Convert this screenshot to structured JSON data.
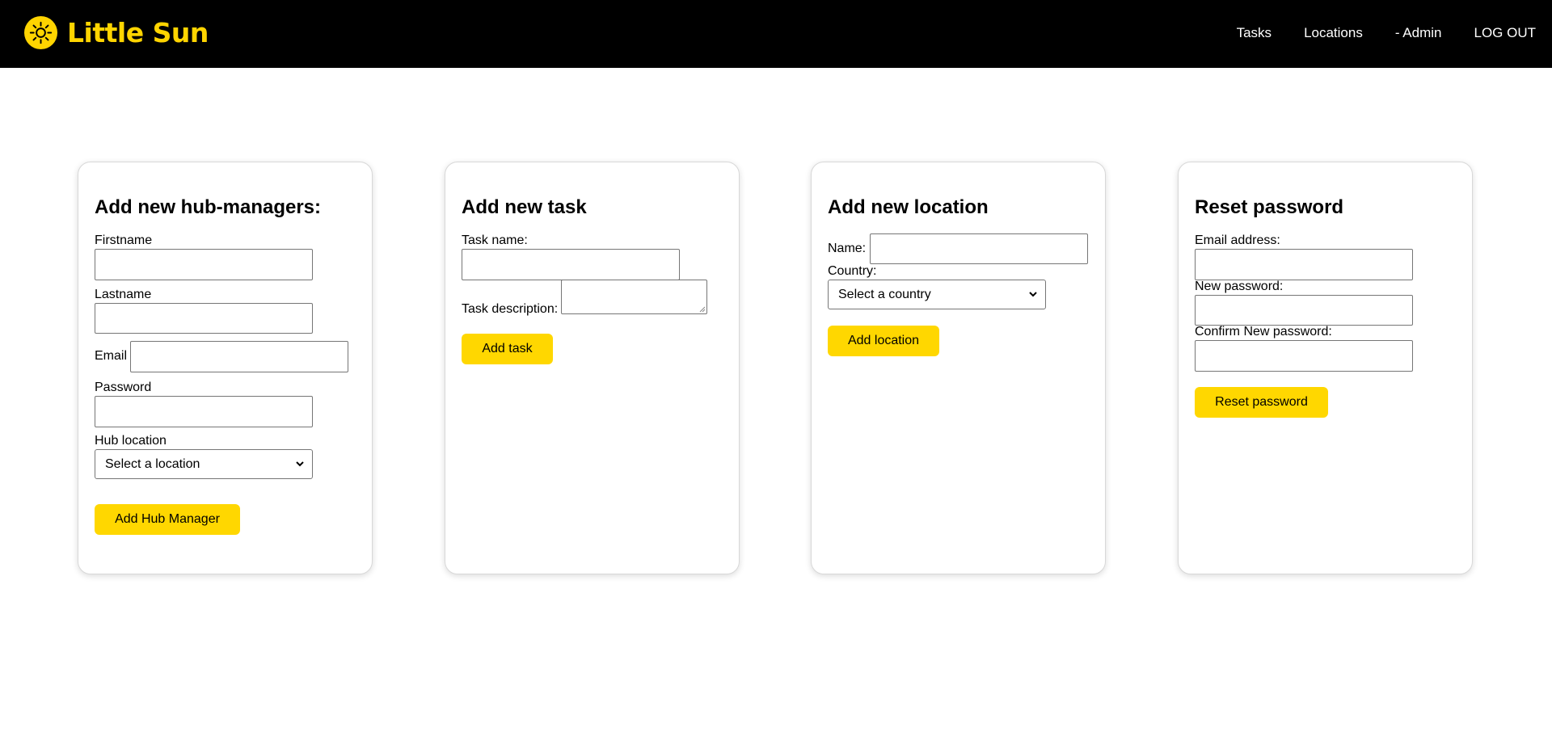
{
  "header": {
    "brand_name": "Little Sun",
    "logo_icon": "sun-icon",
    "brand_color": "#ffd400",
    "nav": {
      "tasks": "Tasks",
      "locations": "Locations",
      "admin": "- Admin",
      "logout": "LOG OUT"
    }
  },
  "hub_managers": {
    "title": "Add new hub-managers:",
    "firstname_label": "Firstname",
    "firstname_value": "",
    "lastname_label": "Lastname",
    "lastname_value": "",
    "email_label": "Email",
    "email_value": "",
    "password_label": "Password",
    "password_value": "",
    "hub_location_label": "Hub location",
    "hub_location_selected": "Select a location",
    "submit_label": "Add Hub Manager"
  },
  "task": {
    "title": "Add new task",
    "name_label": "Task name:",
    "name_value": "",
    "description_label": "Task description:",
    "description_value": "",
    "submit_label": "Add task"
  },
  "location": {
    "title": "Add new location",
    "name_label": "Name:",
    "name_value": "",
    "country_label": "Country:",
    "country_selected": "Select a country",
    "submit_label": "Add location"
  },
  "reset_password": {
    "title": "Reset password",
    "email_label": "Email address:",
    "email_value": "",
    "new_password_label": "New password:",
    "new_password_value": "",
    "confirm_label": "Confirm New password:",
    "confirm_value": "",
    "submit_label": "Reset password"
  },
  "colors": {
    "accent": "#ffd700",
    "header_bg": "#000000"
  }
}
